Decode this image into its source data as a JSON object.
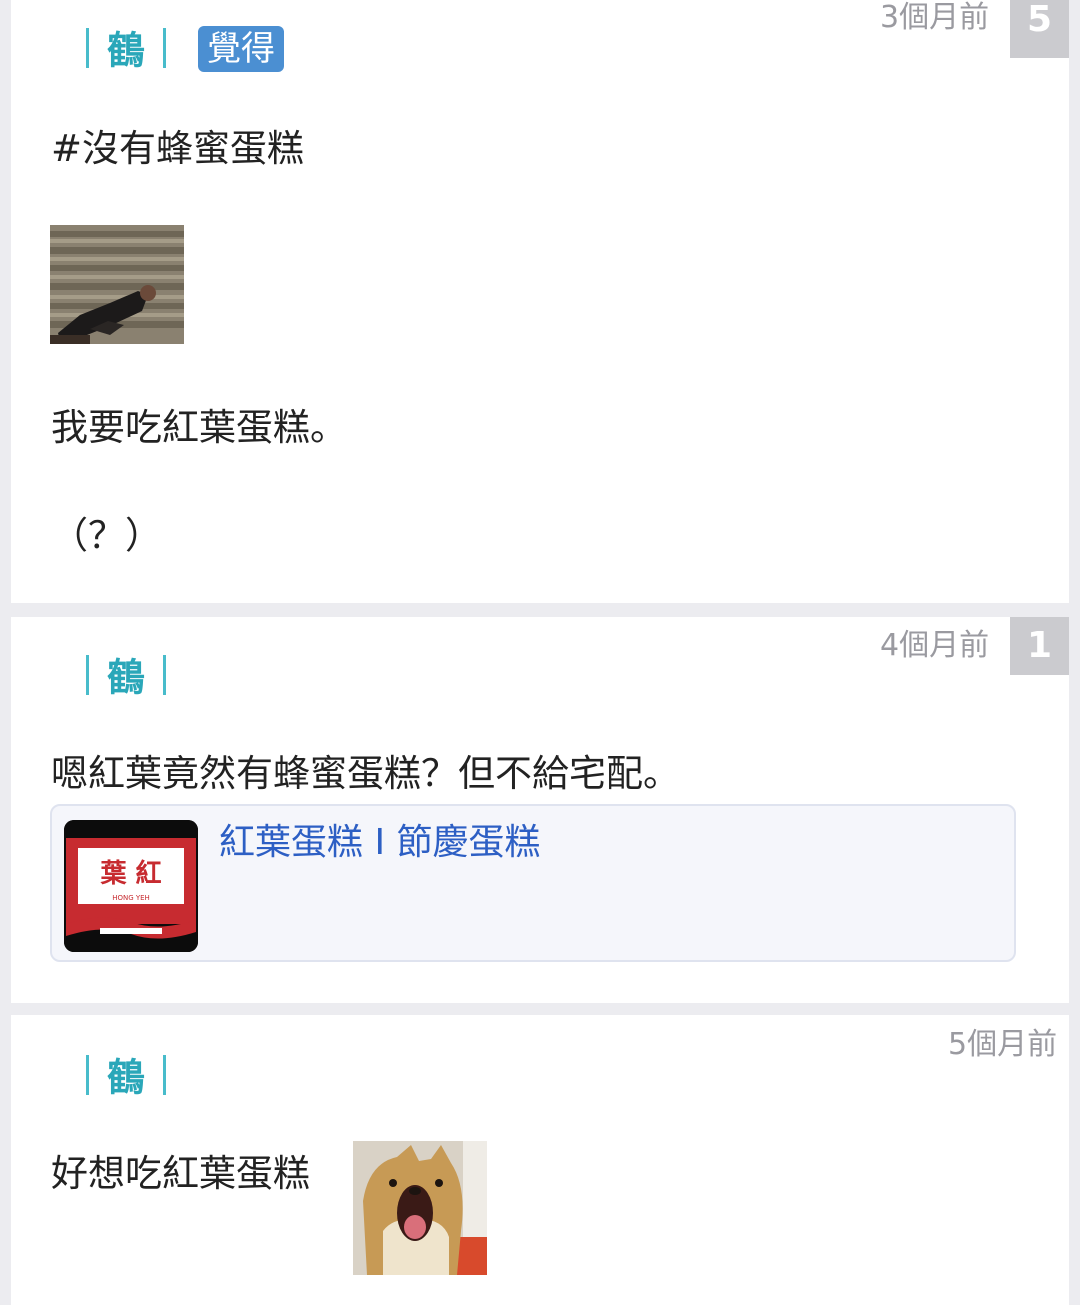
{
  "comments": [
    {
      "author": "鶴",
      "tag": "覺得",
      "time": "3個月前",
      "votes": "5",
      "lines": [
        "#沒有蜂蜜蛋糕",
        "我要吃紅葉蛋糕。",
        "（？）"
      ]
    },
    {
      "author": "鶴",
      "time": "4個月前",
      "votes": "1",
      "lines": [
        "嗯紅葉竟然有蜂蜜蛋糕？但不給宅配。"
      ],
      "link": {
        "title": "紅葉蛋糕 I 節慶蛋糕",
        "logo_chars": "葉 紅",
        "logo_sub": "HONG  YEH"
      }
    },
    {
      "author": "鶴",
      "time": "5個月前",
      "lines": [
        "好想吃紅葉蛋糕"
      ]
    }
  ],
  "colors": {
    "author": "#2aa7b9",
    "tag_bg": "#4b8fd2",
    "link": "#2d5fc4",
    "vote_bg": "#cbcbcf"
  }
}
